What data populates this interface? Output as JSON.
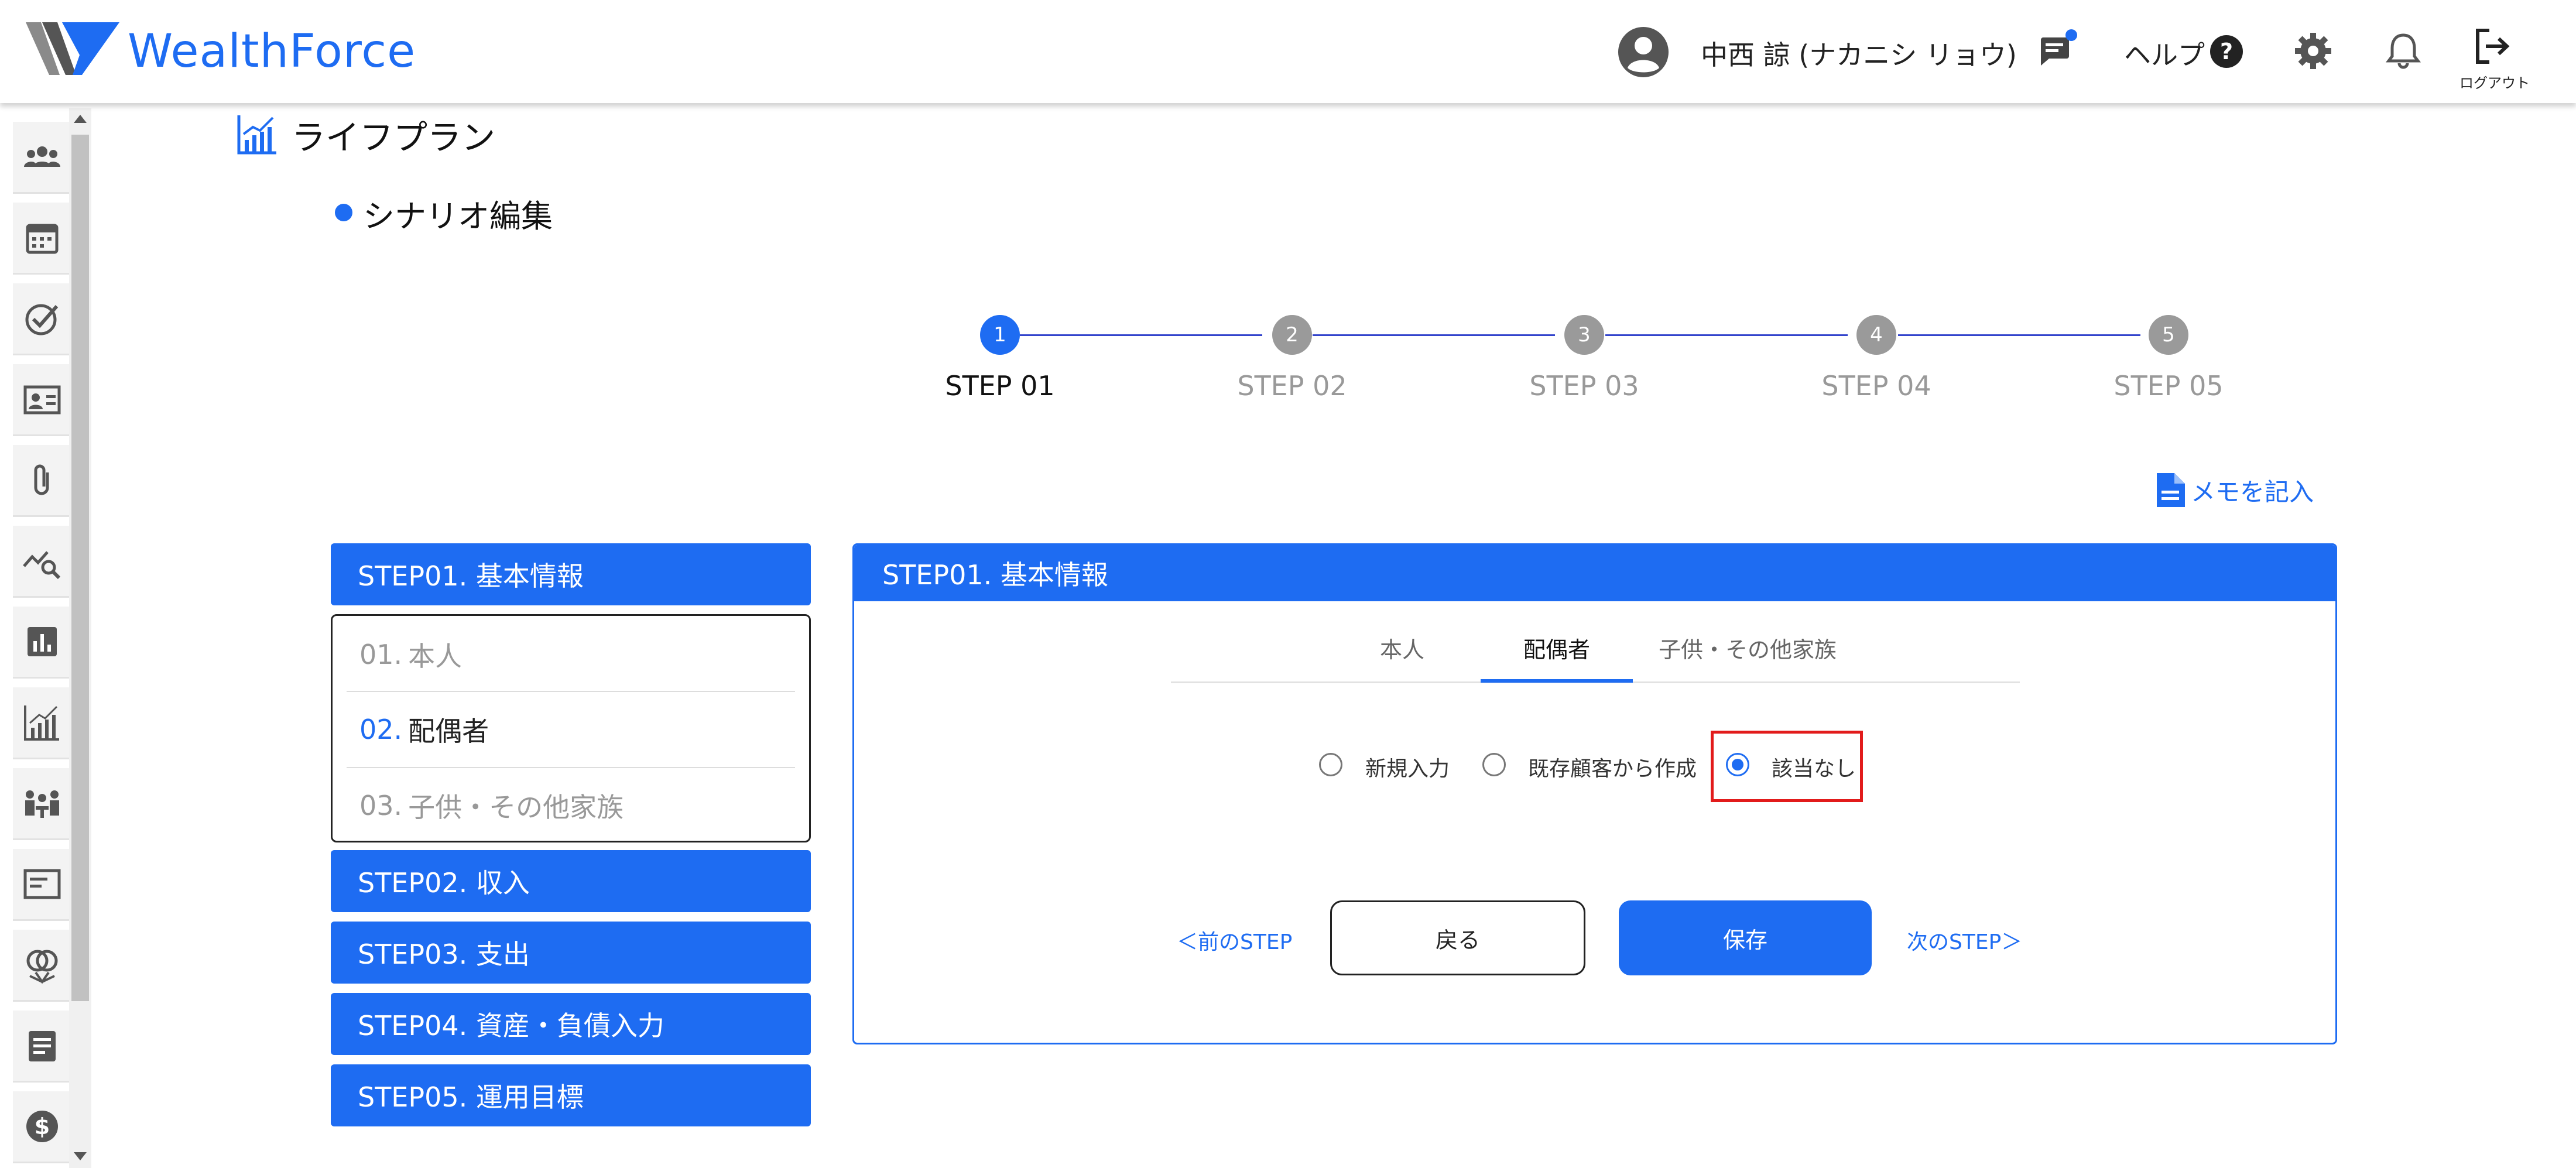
{
  "header": {
    "logo_text": "WealthForce",
    "user_name": "中西 諒 (ナカニシ リョウ)",
    "help_label": "ヘルプ",
    "logout_label": "ログアウト",
    "brand_color": "#1e6cf2"
  },
  "sidebar": {
    "icons": [
      "people-icon",
      "calendar-icon",
      "check-circle-icon",
      "id-card-icon",
      "paperclip-icon",
      "chart-search-icon",
      "bar-chart-icon",
      "growth-chart-icon",
      "meeting-icon",
      "card-icon",
      "rings-icon",
      "document-icon",
      "dollar-icon"
    ]
  },
  "page": {
    "title": "ライフプラン",
    "section_title": "シナリオ編集"
  },
  "stepper": {
    "steps": [
      {
        "number": "1",
        "label": "STEP 01",
        "active": true
      },
      {
        "number": "2",
        "label": "STEP 02",
        "active": false
      },
      {
        "number": "3",
        "label": "STEP 03",
        "active": false
      },
      {
        "number": "4",
        "label": "STEP 04",
        "active": false
      },
      {
        "number": "5",
        "label": "STEP 05",
        "active": false
      }
    ]
  },
  "memo_label": "メモを記入",
  "left_nav": {
    "step01": "STEP01. 基本情報",
    "sub_items": [
      {
        "num": "01.",
        "label": "本人"
      },
      {
        "num": "02.",
        "label": "配偶者"
      },
      {
        "num": "03.",
        "label": "子供・その他家族"
      }
    ],
    "step02": "STEP02. 収入",
    "step03": "STEP03. 支出",
    "step04": "STEP04. 資産・負債入力",
    "step05": "STEP05. 運用目標"
  },
  "panel": {
    "title": "STEP01. 基本情報",
    "tabs": [
      "本人",
      "配偶者",
      "子供・その他家族"
    ],
    "active_tab": "配偶者",
    "radio_options": [
      "新規入力",
      "既存顧客から作成",
      "該当なし"
    ],
    "selected_option": "該当なし",
    "prev_step": "＜前のSTEP",
    "back_label": "戻る",
    "save_label": "保存",
    "next_step": "次のSTEP＞"
  }
}
